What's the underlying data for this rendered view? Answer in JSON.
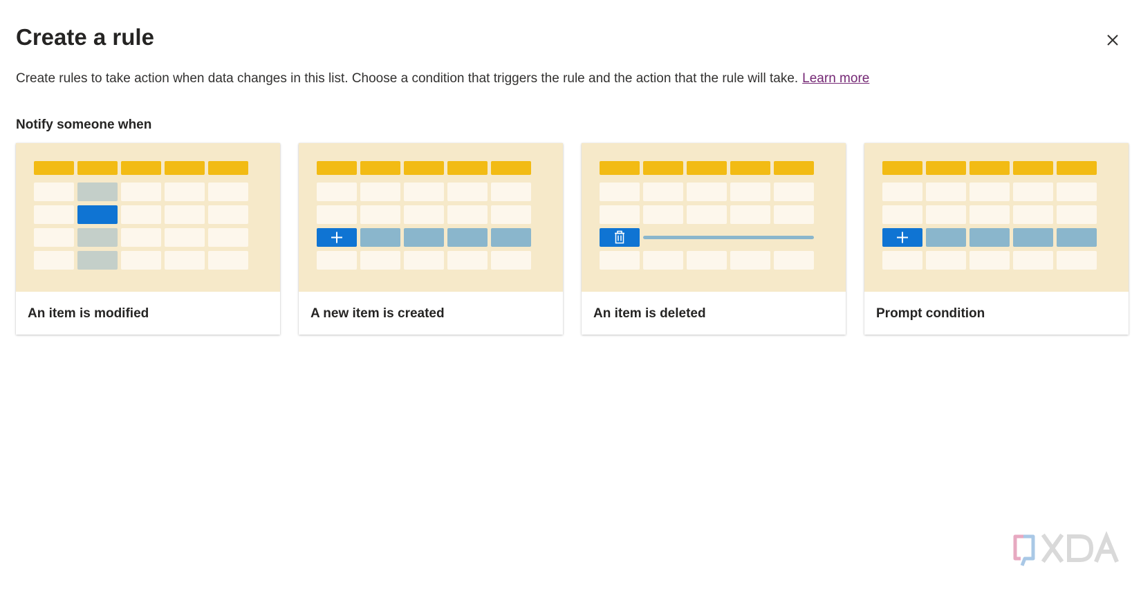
{
  "dialog": {
    "title": "Create a rule",
    "description": "Create rules to take action when data changes in this list. Choose a condition that triggers the rule and the action that the rule will take.",
    "learn_more": "Learn more",
    "section_label": "Notify someone when",
    "close_icon": "close-icon"
  },
  "cards": [
    {
      "label": "An item is modified",
      "illustration": "modified"
    },
    {
      "label": "A new item is created",
      "illustration": "created"
    },
    {
      "label": "An item is deleted",
      "illustration": "deleted"
    },
    {
      "label": "Prompt condition",
      "illustration": "prompt"
    }
  ],
  "colors": {
    "illustration_bg": "#f6e9c9",
    "header_cell": "#f2bb14",
    "empty_cell": "#fdf7ec",
    "highlight_blue": "#0f74d3",
    "pale_blue": "#8ab6cc",
    "gray_cell": "#c4cfc9",
    "link": "#742774"
  },
  "watermark": {
    "brand": "XDA"
  }
}
